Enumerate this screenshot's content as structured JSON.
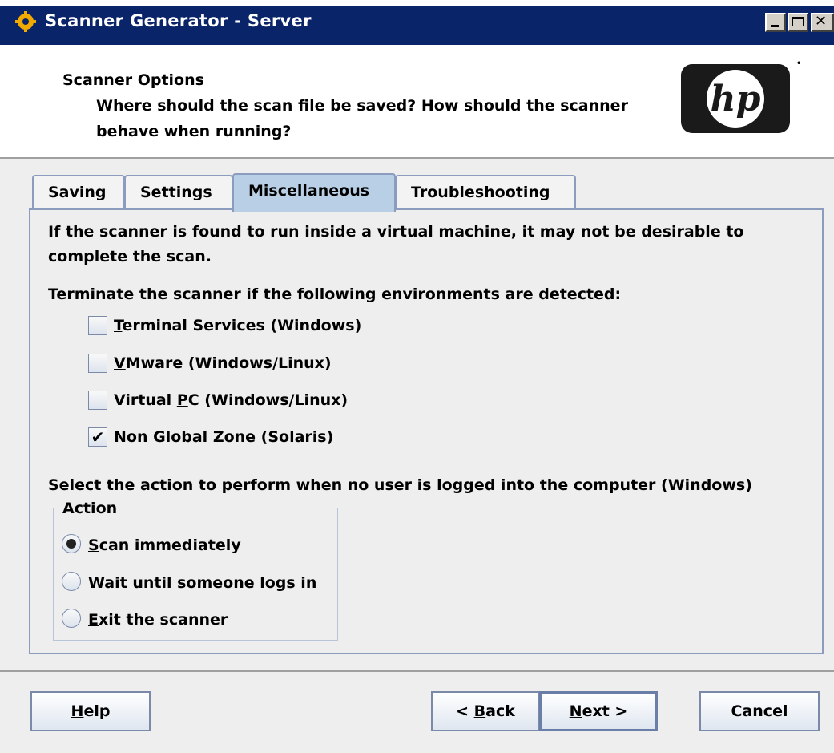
{
  "window": {
    "title": "Scanner Generator - Server",
    "icon": "gear-icon",
    "controls": [
      "minimize-icon",
      "maximize-icon",
      "close-icon"
    ]
  },
  "header": {
    "title": "Scanner Options",
    "description": "Where should the scan file be saved?  How should the scanner behave when running?",
    "logo_text": "hp"
  },
  "tabs": [
    {
      "label": "Saving",
      "selected": false
    },
    {
      "label": "Settings",
      "selected": false
    },
    {
      "label": "Miscellaneous",
      "selected": true
    },
    {
      "label": "Troubleshooting",
      "selected": false
    }
  ],
  "misc": {
    "intro": "If the scanner is found to run inside a virtual machine, it may not be desirable to complete the scan.",
    "intro_line1": "If the scanner is found to run inside a virtual machine, it may not be desirable to",
    "intro_line2": "complete the scan.",
    "terminate_label": "Terminate the scanner if the following environments are detected:",
    "environments": [
      {
        "mnemonic": "T",
        "rest": "erminal Services (Windows)",
        "checked": false,
        "check_mark": ""
      },
      {
        "mnemonic": "V",
        "rest": "Mware (Windows/Linux)",
        "checked": false,
        "check_mark": ""
      },
      {
        "prefix": "Virtual ",
        "mnemonic": "P",
        "rest": "C (Windows/Linux)",
        "checked": false,
        "check_mark": ""
      },
      {
        "prefix": "Non Global ",
        "mnemonic": "Z",
        "rest": "one (Solaris)",
        "checked": true,
        "check_mark": "✔"
      }
    ],
    "action_prompt": "Select the action to perform when no user is logged into the computer (Windows)",
    "action_group_label": "Action",
    "actions": [
      {
        "mnemonic": "S",
        "rest": "can immediately",
        "selected": true
      },
      {
        "mnemonic": "W",
        "rest": "ait until someone logs in",
        "selected": false
      },
      {
        "mnemonic": "E",
        "rest": "xit the scanner",
        "selected": false
      }
    ]
  },
  "buttons": {
    "help": {
      "mnemonic": "H",
      "rest": "elp"
    },
    "back": {
      "prefix": "< ",
      "mnemonic": "B",
      "rest": "ack"
    },
    "next": {
      "mnemonic": "N",
      "rest": "ext >"
    },
    "cancel": {
      "label": "Cancel"
    }
  },
  "colors": {
    "titlebar": "#0a246a",
    "selected_tab": "#b8cfe5",
    "panel_border": "#8c9cbf"
  }
}
